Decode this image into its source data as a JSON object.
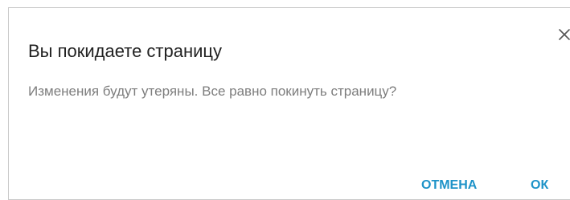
{
  "dialog": {
    "title": "Вы покидаете страницу",
    "message": "Изменения будут утеряны. Все равно покинуть страницу?",
    "close_icon": "close-icon",
    "buttons": {
      "cancel_label": "ОТМЕНА",
      "ok_label": "ОК"
    }
  },
  "colors": {
    "title": "#222222",
    "message": "#7d7d7d",
    "accent": "#1e93c8",
    "border": "#c9c9c9",
    "close_icon": "#555555"
  }
}
